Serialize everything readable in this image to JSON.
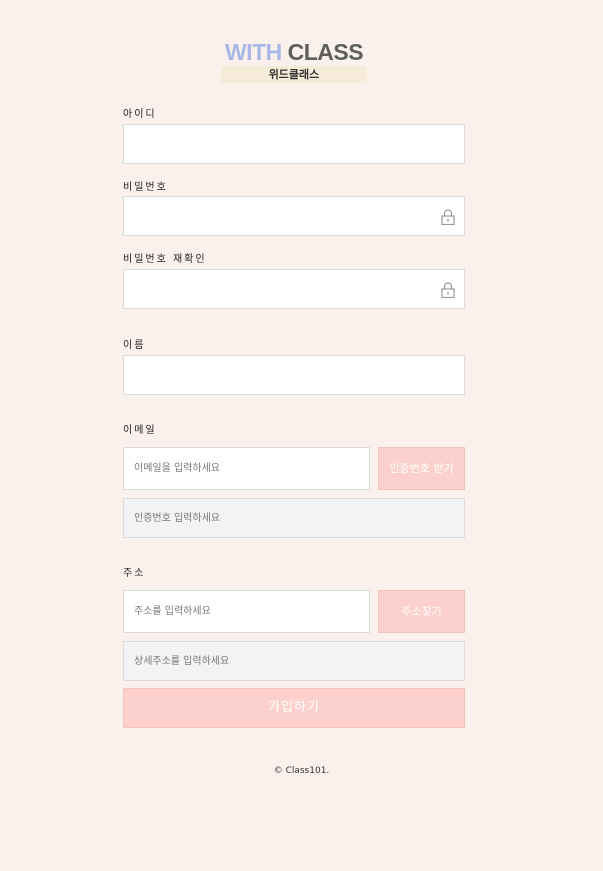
{
  "logo": {
    "word1": "WITH",
    "word2": "CLASS",
    "subtitle": "위드클래스"
  },
  "form": {
    "id_label": "아이디",
    "id_value": "",
    "password_label": "비밀번호",
    "password_value": "",
    "password_confirm_label": "비밀번호 재확인",
    "password_confirm_value": "",
    "name_label": "이름",
    "name_value": "",
    "email_label": "이메일",
    "email_placeholder": "이메일을 입력하세요",
    "email_code_button": "인증번호 받기",
    "code_placeholder": "인증번호 입력하세요",
    "address_label": "주소",
    "address_placeholder": "주소를 입력하세요",
    "address_search_button": "주소찾기",
    "address_detail_placeholder": "상세주소를 입력하세요",
    "submit_label": "가입하기"
  },
  "icons": {
    "password_lock": "lock-icon",
    "password_confirm_lock": "lock-icon"
  },
  "colors": {
    "background": "#fbf1ec",
    "button": "#fcd1cd",
    "logo_with": "#a8b7e6",
    "logo_class": "#5e5e5e"
  },
  "footer": {
    "copyright": "© Class101."
  }
}
